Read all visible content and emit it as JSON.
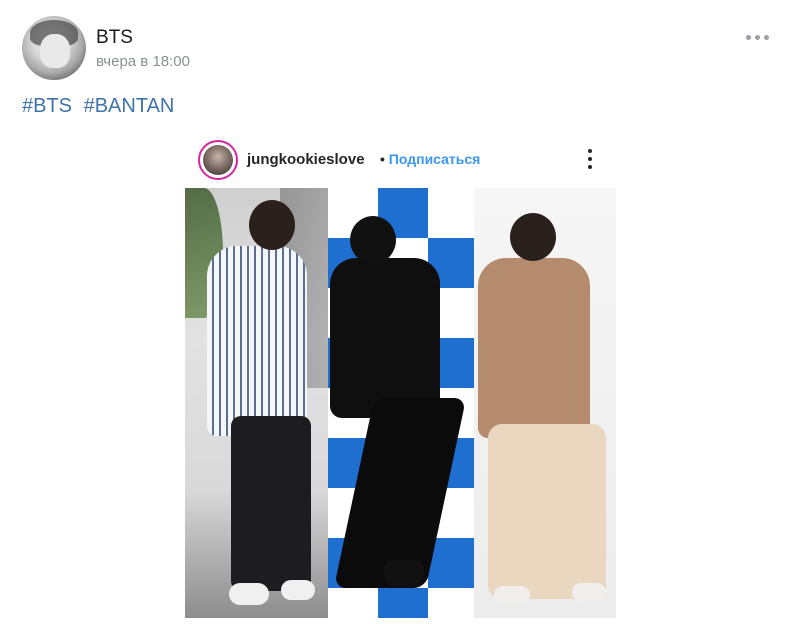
{
  "post": {
    "author": "BTS",
    "time": "вчера в 18:00",
    "hashtags": [
      "#BTS",
      "#BANTAN"
    ]
  },
  "instagram": {
    "username": "jungkookieslove",
    "separator": "•",
    "follow_label": "Подписаться"
  },
  "colors": {
    "link": "#3f73aa",
    "follow": "#3897f0",
    "meta": "#8a8f96"
  },
  "icons": {
    "more": "more-dots-icon",
    "ig_more": "vertical-dots-icon"
  }
}
